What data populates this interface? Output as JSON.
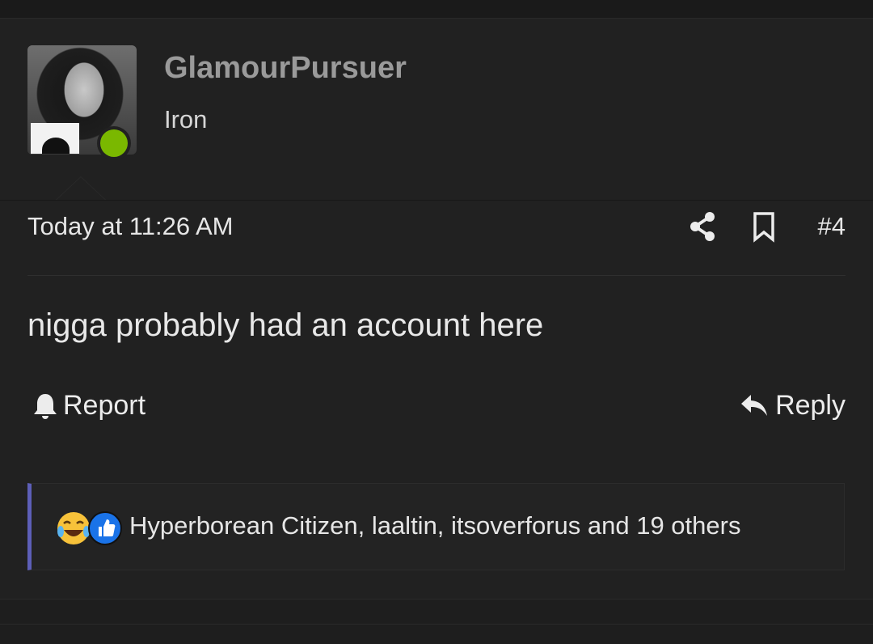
{
  "post": {
    "user": {
      "name": "GlamourPursuer",
      "rank": "Iron",
      "online_color": "#7ab800",
      "avatar": "user-avatar-photo"
    },
    "timestamp": "Today at 11:26 AM",
    "post_number": "#4",
    "icons": {
      "share": "share-icon",
      "bookmark": "bookmark-icon",
      "report": "bell-icon",
      "reply": "reply-arrow-icon",
      "reaction_1": "laughing-crying-emoji",
      "reaction_2": "thumbs-up-emoji"
    },
    "message": "nigga probably had an account here",
    "actions": {
      "report_label": "Report",
      "reply_label": "Reply"
    },
    "reactions": {
      "text": "Hyperborean Citizen, laaltin, itsoverforus and 19 others",
      "accent_color": "#5d5fb8"
    }
  }
}
